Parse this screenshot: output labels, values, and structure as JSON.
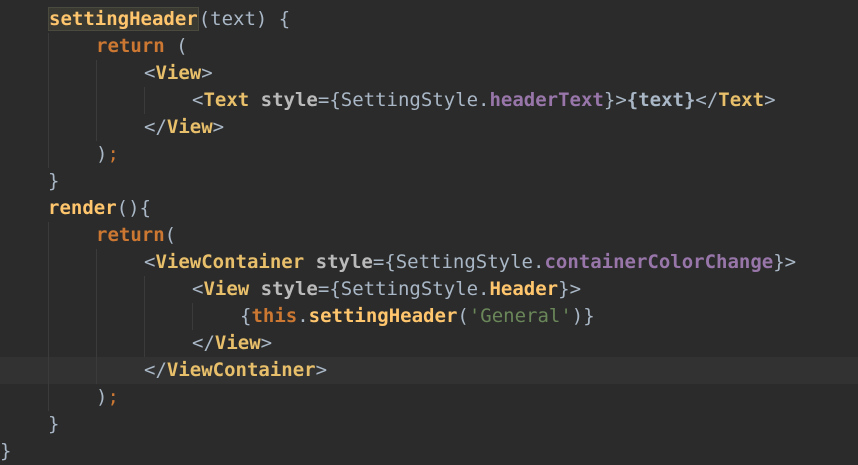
{
  "editor": {
    "theme_bg": "#2b2b2b",
    "lines": [
      {
        "indent": 0,
        "tokens": [
          [
            "fnhl",
            "settingHeader"
          ],
          [
            "punc",
            "(text) {"
          ]
        ]
      },
      {
        "indent": 1,
        "tokens": [
          [
            "kw",
            "return"
          ],
          [
            "punc",
            " ("
          ]
        ]
      },
      {
        "indent": 2,
        "tokens": [
          [
            "punc",
            "<"
          ],
          [
            "tag",
            "View"
          ],
          [
            "punc",
            ">"
          ]
        ]
      },
      {
        "indent": 3,
        "tokens": [
          [
            "punc",
            "<"
          ],
          [
            "tag",
            "Text"
          ],
          [
            "punc",
            " "
          ],
          [
            "attr",
            "style"
          ],
          [
            "punc",
            "="
          ],
          [
            "punc",
            "{SettingStyle."
          ],
          [
            "prop",
            "headerText"
          ],
          [
            "punc",
            "}>"
          ],
          [
            "plain",
            "{text}"
          ],
          [
            "punc",
            "</"
          ],
          [
            "tag",
            "Text"
          ],
          [
            "punc",
            ">"
          ]
        ]
      },
      {
        "indent": 2,
        "tokens": [
          [
            "punc",
            "</"
          ],
          [
            "tag",
            "View"
          ],
          [
            "punc",
            ">"
          ]
        ]
      },
      {
        "indent": 1,
        "tokens": [
          [
            "punc",
            ")"
          ],
          [
            "semi",
            ";"
          ]
        ]
      },
      {
        "indent": 0,
        "tokens": [
          [
            "punc",
            "}"
          ]
        ]
      },
      {
        "indent": 0,
        "tokens": [
          [
            "fn",
            "render"
          ],
          [
            "punc",
            "(){"
          ]
        ]
      },
      {
        "indent": 1,
        "tokens": [
          [
            "kw",
            "return"
          ],
          [
            "punc",
            "("
          ]
        ]
      },
      {
        "indent": 2,
        "tokens": [
          [
            "punc",
            "<"
          ],
          [
            "tag",
            "ViewContainer"
          ],
          [
            "punc",
            " "
          ],
          [
            "attr",
            "style"
          ],
          [
            "punc",
            "="
          ],
          [
            "punc",
            "{SettingStyle."
          ],
          [
            "prop",
            "containerColorChange"
          ],
          [
            "punc",
            "}>"
          ]
        ]
      },
      {
        "indent": 3,
        "tokens": [
          [
            "punc",
            "<"
          ],
          [
            "tag",
            "View"
          ],
          [
            "punc",
            " "
          ],
          [
            "attr",
            "style"
          ],
          [
            "punc",
            "="
          ],
          [
            "punc",
            "{SettingStyle."
          ],
          [
            "fn",
            "Header"
          ],
          [
            "punc",
            "}>"
          ]
        ]
      },
      {
        "indent": 4,
        "tokens": [
          [
            "punc",
            "{"
          ],
          [
            "kw",
            "this"
          ],
          [
            "punc",
            "."
          ],
          [
            "fn",
            "settingHeader"
          ],
          [
            "punc",
            "("
          ],
          [
            "str",
            "'General'"
          ],
          [
            "punc",
            ")}"
          ]
        ]
      },
      {
        "indent": 3,
        "tokens": [
          [
            "punc",
            "</"
          ],
          [
            "tag",
            "View"
          ],
          [
            "punc",
            ">"
          ]
        ]
      },
      {
        "indent": 2,
        "tokens": [
          [
            "punc",
            "</"
          ],
          [
            "tag",
            "ViewContainer"
          ],
          [
            "punc",
            ">"
          ]
        ],
        "current": true
      },
      {
        "indent": 1,
        "tokens": [
          [
            "punc",
            ")"
          ],
          [
            "semi",
            ";"
          ]
        ]
      },
      {
        "indent": 0,
        "tokens": [
          [
            "punc",
            "}"
          ]
        ]
      },
      {
        "indent": -1,
        "tokens": [
          [
            "punc",
            "}"
          ]
        ]
      }
    ]
  }
}
